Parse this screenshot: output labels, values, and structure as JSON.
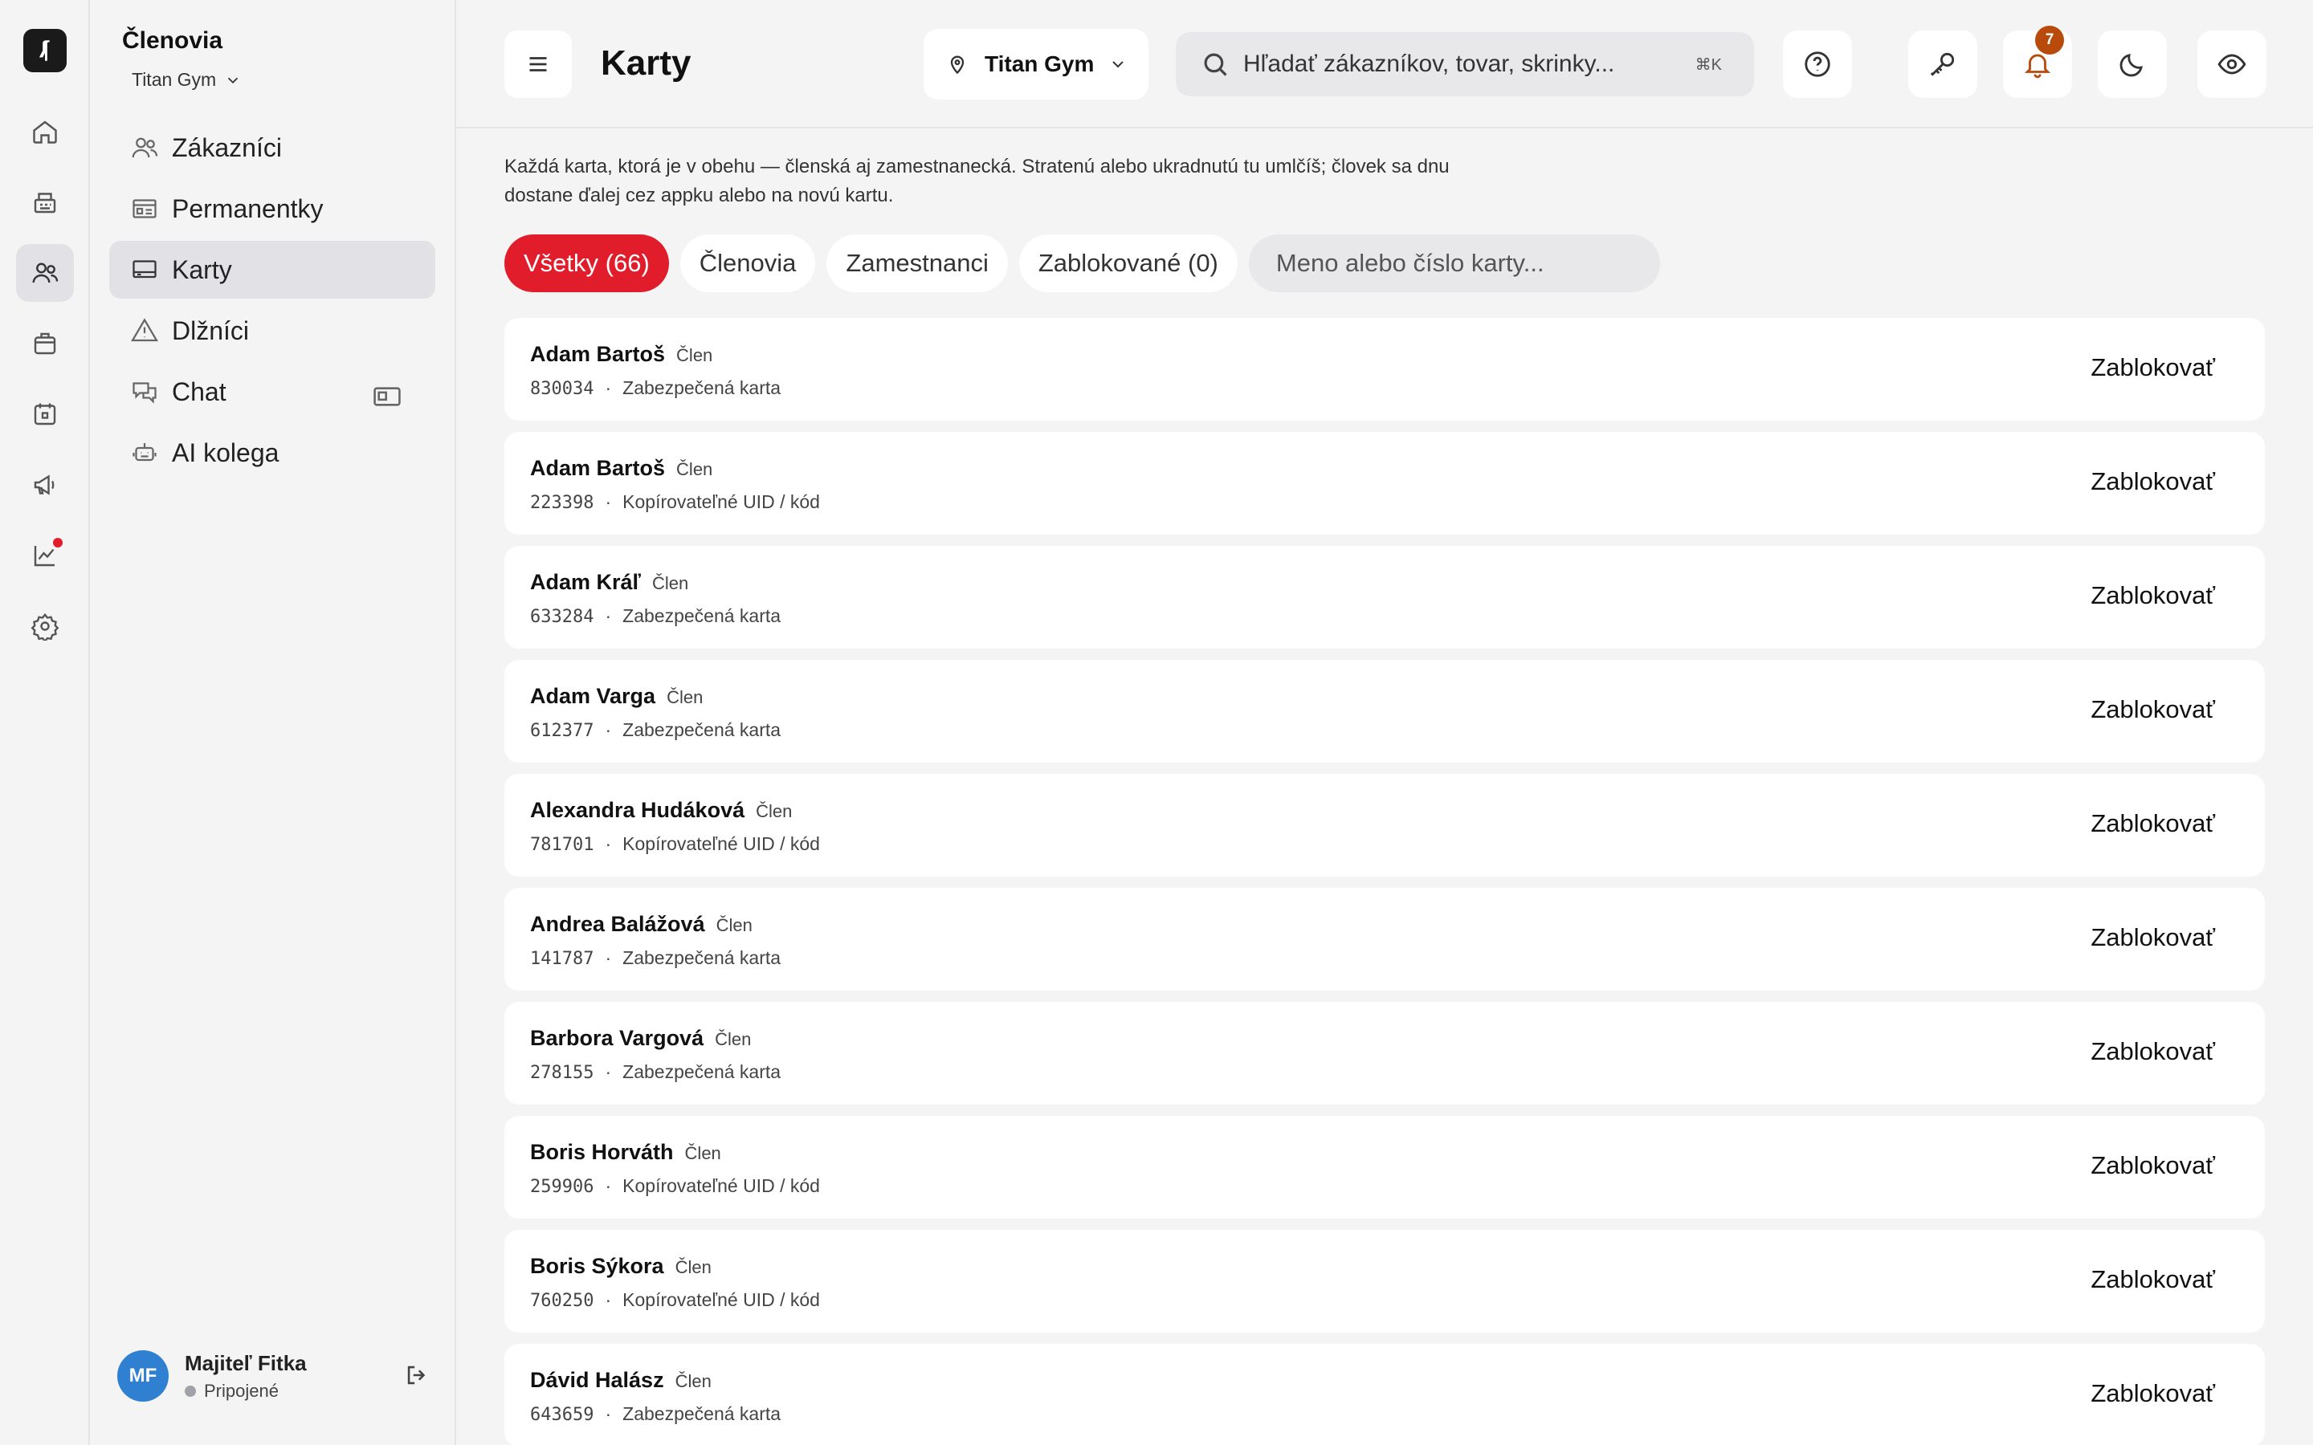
{
  "rail": {
    "items": [
      {
        "icon": "home-icon"
      },
      {
        "icon": "register-icon"
      },
      {
        "icon": "users-icon",
        "active": true
      },
      {
        "icon": "shop-icon"
      },
      {
        "icon": "calendar-icon"
      },
      {
        "icon": "megaphone-icon"
      },
      {
        "icon": "chart-icon",
        "dot": true
      },
      {
        "icon": "gear-icon"
      }
    ],
    "accent": "#e11d2b"
  },
  "sidebar": {
    "title": "Členovia",
    "gym": "Titan Gym",
    "items": [
      {
        "label": "Zákazníci",
        "icon": "users-icon"
      },
      {
        "label": "Permanentky",
        "icon": "membership-card-icon"
      },
      {
        "label": "Karty",
        "icon": "card-icon",
        "active": true
      },
      {
        "label": "Dlžníci",
        "icon": "warning-icon"
      },
      {
        "label": "Chat",
        "icon": "chat-icon"
      },
      {
        "label": "AI kolega",
        "icon": "robot-icon"
      }
    ],
    "user": {
      "initials": "MF",
      "name": "Majiteľ Fitka",
      "status": "Pripojené"
    }
  },
  "header": {
    "title": "Karty",
    "location": "Titan Gym",
    "search_placeholder": "Hľadať zákazníkov, tovar, skrinky...",
    "search_shortcut": "⌘K",
    "notification_count": "7"
  },
  "content": {
    "description": "Každá karta, ktorá je v obehu — členská aj zamestnanecká. Stratenú alebo ukradnutú tu umlčíš; človek sa dnu dostane ďalej cez appku alebo na novú kartu.",
    "filters": [
      {
        "label": "Všetky (66)",
        "active": true
      },
      {
        "label": "Členovia"
      },
      {
        "label": "Zamestnanci"
      },
      {
        "label": "Zablokované (0)"
      }
    ],
    "filter_search_placeholder": "Meno alebo číslo karty...",
    "action_label": "Zablokovať",
    "cards": [
      {
        "name": "Adam Bartoš",
        "role": "Člen",
        "number": "830034",
        "type": "Zabezpečená karta"
      },
      {
        "name": "Adam Bartoš",
        "role": "Člen",
        "number": "223398",
        "type": "Kopírovateľné UID / kód"
      },
      {
        "name": "Adam Kráľ",
        "role": "Člen",
        "number": "633284",
        "type": "Zabezpečená karta"
      },
      {
        "name": "Adam Varga",
        "role": "Člen",
        "number": "612377",
        "type": "Zabezpečená karta"
      },
      {
        "name": "Alexandra Hudáková",
        "role": "Člen",
        "number": "781701",
        "type": "Kopírovateľné UID / kód"
      },
      {
        "name": "Andrea Balážová",
        "role": "Člen",
        "number": "141787",
        "type": "Zabezpečená karta"
      },
      {
        "name": "Barbora Vargová",
        "role": "Člen",
        "number": "278155",
        "type": "Zabezpečená karta"
      },
      {
        "name": "Boris Horváth",
        "role": "Člen",
        "number": "259906",
        "type": "Kopírovateľné UID / kód"
      },
      {
        "name": "Boris Sýkora",
        "role": "Člen",
        "number": "760250",
        "type": "Kopírovateľné UID / kód"
      },
      {
        "name": "Dávid Halász",
        "role": "Člen",
        "number": "643659",
        "type": "Zabezpečená karta"
      }
    ]
  }
}
